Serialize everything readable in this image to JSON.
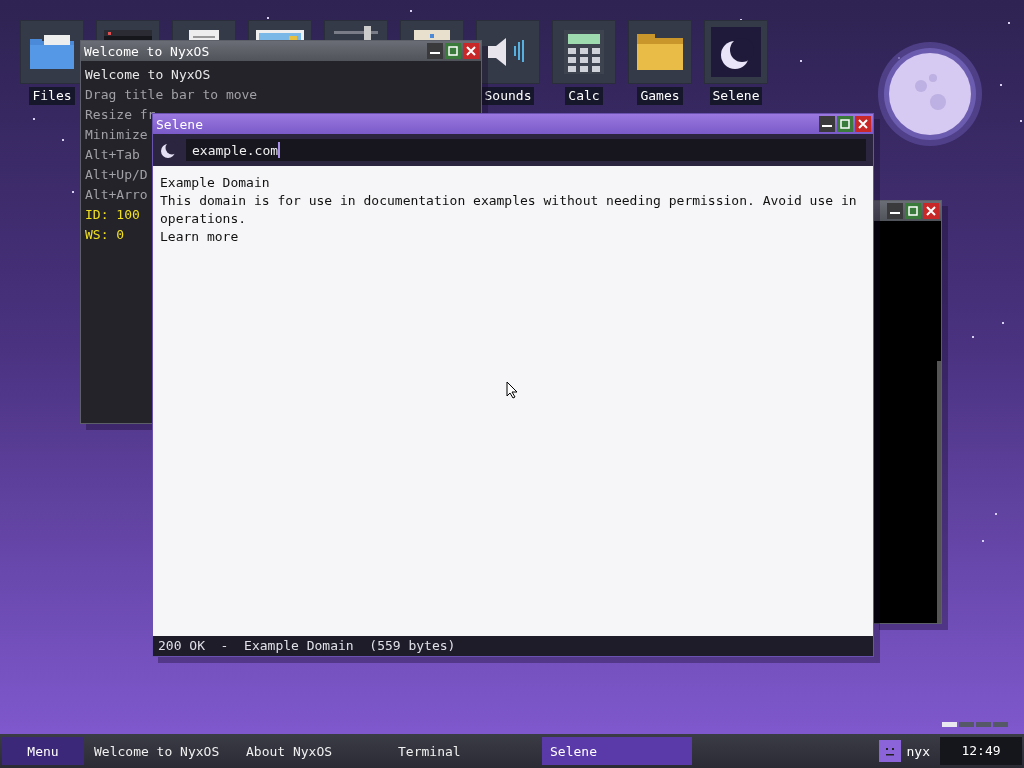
{
  "desktop_icons": [
    {
      "kind": "files",
      "label": "Files"
    },
    {
      "kind": "terminal"
    },
    {
      "kind": "document"
    },
    {
      "kind": "image"
    },
    {
      "kind": "slider"
    },
    {
      "kind": "notes"
    },
    {
      "kind": "sounds",
      "label": "Sounds"
    },
    {
      "kind": "calc",
      "label": "Calc"
    },
    {
      "kind": "games",
      "label": "Games"
    },
    {
      "kind": "selene",
      "label": "Selene"
    }
  ],
  "welcome_window": {
    "title": "Welcome to NyxOS",
    "lines": [
      {
        "kind": "heading",
        "text": "Welcome to NyxOS"
      },
      {
        "kind": "hint",
        "text": "Drag title bar to move"
      },
      {
        "kind": "hint",
        "text": "Resize fr"
      },
      {
        "kind": "hint",
        "text": "Minimize"
      },
      {
        "kind": "hint",
        "text": "Alt+Tab"
      },
      {
        "kind": "hint",
        "text": "Alt+Up/D"
      },
      {
        "kind": "hint",
        "text": "Alt+Arro"
      },
      {
        "kind": "info",
        "text": "ID: 100"
      },
      {
        "kind": "info",
        "text": "WS: 0"
      }
    ]
  },
  "browser_window": {
    "title": "Selene",
    "url": "example.com",
    "page": {
      "heading": "Example Domain",
      "body": "This domain is for use in documentation examples without needing permission. Avoid use in operations.",
      "link": "Learn more"
    },
    "status": "200 OK  -  Example Domain  (559 bytes)"
  },
  "workspaces": [
    {
      "selected": true
    },
    {
      "selected": false
    },
    {
      "selected": false
    },
    {
      "selected": false
    }
  ],
  "taskbar": {
    "menu": "Menu",
    "tasks": [
      {
        "label": "Welcome to NyxOS",
        "selected": false
      },
      {
        "label": "About NyxOS",
        "selected": false
      },
      {
        "label": "Terminal",
        "selected": false
      },
      {
        "label": "Selene",
        "selected": true
      }
    ],
    "user": "nyx",
    "clock": "12:49"
  }
}
